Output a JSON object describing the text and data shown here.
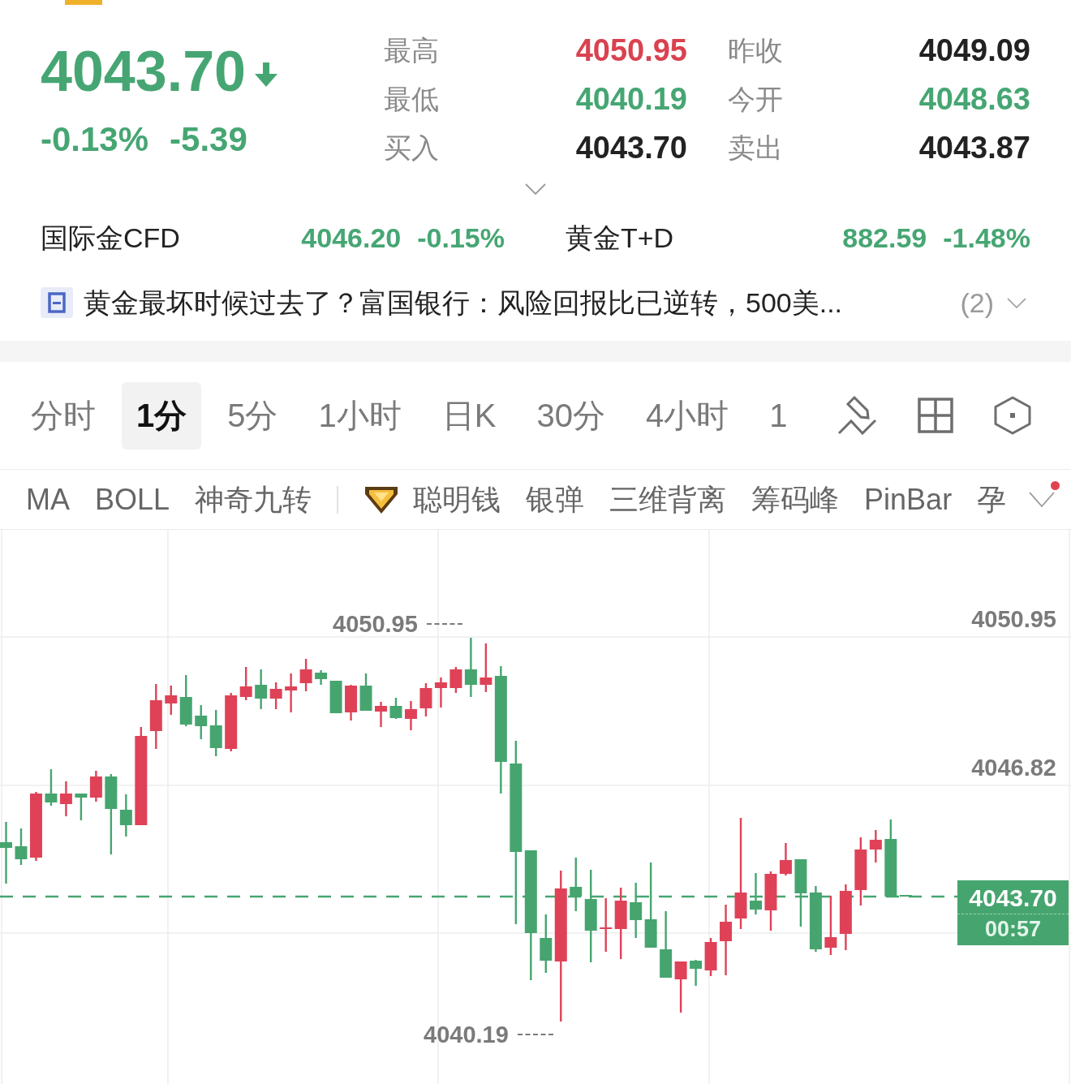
{
  "quote": {
    "price": "4043.70",
    "falling": true,
    "change_percent": "-0.13%",
    "change": "-5.39"
  },
  "stats": [
    {
      "label": "最高",
      "value": "4050.95",
      "color": "#d9424f"
    },
    {
      "label": "昨收",
      "value": "4049.09",
      "color": "#222222"
    },
    {
      "label": "最低",
      "value": "4040.19",
      "color": "#46a673"
    },
    {
      "label": "今开",
      "value": "4048.63",
      "color": "#46a673"
    },
    {
      "label": "买入",
      "value": "4043.70",
      "color": "#222222"
    },
    {
      "label": "卖出",
      "value": "4043.87",
      "color": "#222222"
    }
  ],
  "related": [
    {
      "name": "国际金CFD",
      "price": "4046.20",
      "change": "-0.15%",
      "color": "#46a673"
    },
    {
      "name": "黄金T+D",
      "price": "882.59",
      "change": "-1.48%",
      "color": "#46a673"
    }
  ],
  "news": {
    "headline": "黄金最坏时候过去了？富国银行：风险回报比已逆转，500美...",
    "count": "(2)"
  },
  "periods": [
    {
      "label": "分时",
      "selected": false
    },
    {
      "label": "1分",
      "selected": true
    },
    {
      "label": "5分",
      "selected": false
    },
    {
      "label": "1小时",
      "selected": false
    },
    {
      "label": "日K",
      "selected": false
    },
    {
      "label": "30分",
      "selected": false
    },
    {
      "label": "4小时",
      "selected": false
    },
    {
      "label": "1",
      "selected": false
    }
  ],
  "indicators": {
    "main": [
      {
        "label": "MA",
        "premium": false,
        "selected": false
      },
      {
        "label": "BOLL",
        "premium": false,
        "selected": false
      },
      {
        "label": "神奇九转",
        "premium": false,
        "selected": false
      }
    ],
    "extra": [
      {
        "label": "聪明钱",
        "premium": true,
        "selected": false
      },
      {
        "label": "银弹",
        "premium": false,
        "selected": false
      },
      {
        "label": "三维背离",
        "premium": false,
        "selected": false
      },
      {
        "label": "筹码峰",
        "premium": false,
        "selected": false
      },
      {
        "label": "PinBar",
        "premium": false,
        "selected": false
      },
      {
        "label": "孕",
        "premium": false,
        "selected": false
      }
    ],
    "unread": true
  },
  "chart": {
    "axis_labels": [
      "4050.95",
      "4046.82"
    ],
    "high_label": "4050.95",
    "low_label": "4040.19",
    "last_price": "4043.70",
    "countdown": "00:57"
  }
}
